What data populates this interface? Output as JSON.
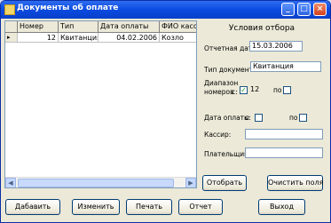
{
  "window": {
    "title": "Документы об оплате"
  },
  "table": {
    "columns": [
      "",
      "Номер",
      "Тип",
      "Дата оплаты",
      "ФИО касс"
    ],
    "rows": [
      {
        "number": "12",
        "type": "Квитанция",
        "date": "04.02.2006",
        "cashier": "Козло"
      }
    ]
  },
  "filter": {
    "title": "Условия отбора",
    "report_date_label": "Отчетная дата:",
    "report_date_value": "15.03.2006",
    "doc_type_label": "Тип документа",
    "doc_type_value": "Квитанция",
    "range_label_line1": "Диапазон",
    "range_label_line2": "номеров",
    "range_from_label": "с:",
    "range_from_checked": true,
    "range_from_value": "12",
    "range_to_label": "по",
    "range_to_checked": false,
    "pay_date_label": "Дата оплаты",
    "pay_date_from_label": "с:",
    "pay_date_to_label": "по",
    "cashier_label": "Кассир:",
    "cashier_value": "",
    "payer_label": "Плательщик",
    "payer_value": "",
    "select_button": "Отобрать",
    "clear_button": "Очистить поля"
  },
  "footer": {
    "add_button": "Дабавить",
    "edit_button": "Изменить",
    "print_button": "Печать",
    "report_button": "Отчет",
    "exit_button": "Выход"
  },
  "colors": {
    "titlebar": "#0b4be0",
    "window_bg": "#ece9d8",
    "close_button": "#d2411c"
  }
}
